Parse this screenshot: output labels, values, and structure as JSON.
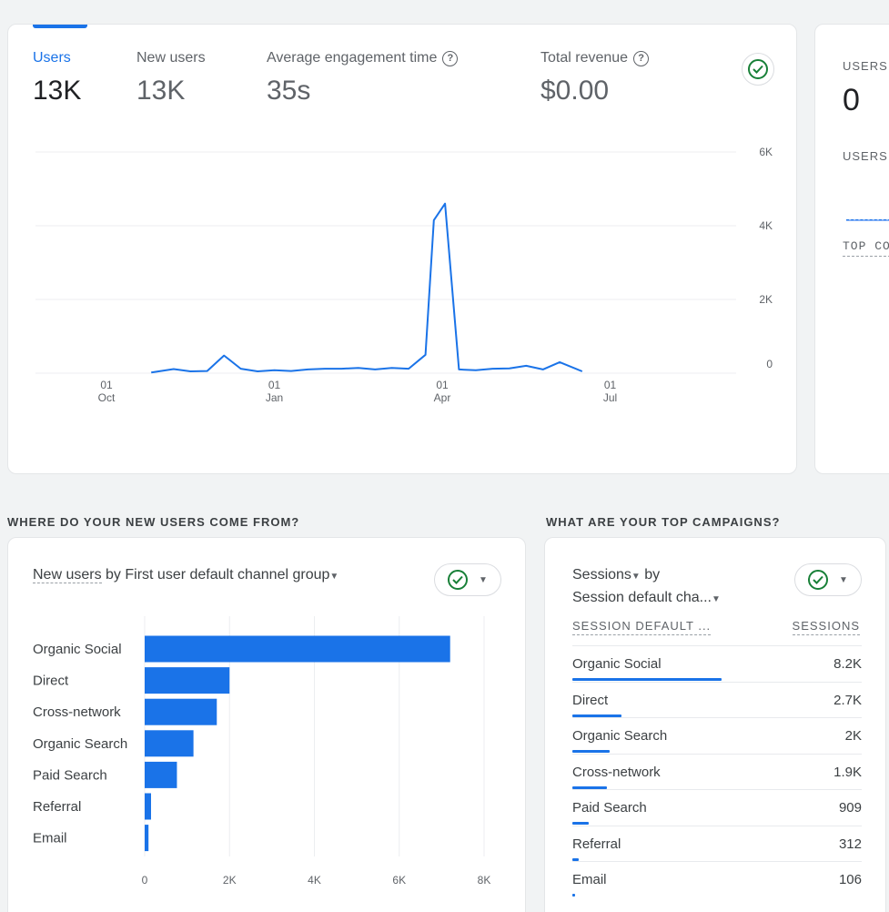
{
  "main_card": {
    "metrics": [
      {
        "label": "Users",
        "value": "13K",
        "active": true,
        "help": false
      },
      {
        "label": "New users",
        "value": "13K",
        "active": false,
        "help": false
      },
      {
        "label": "Average engagement time",
        "value": "35s",
        "active": false,
        "help": true
      },
      {
        "label": "Total revenue",
        "value": "$0.00",
        "active": false,
        "help": true
      }
    ],
    "status_icon": "check-circle-icon"
  },
  "line_chart": {
    "chart_data": {
      "type": "line",
      "y_ticks": [
        "6K",
        "4K",
        "2K",
        "0"
      ],
      "y_values": [
        6000,
        4000,
        2000,
        0
      ],
      "ylim": [
        0,
        6000
      ],
      "x_ticks": [
        {
          "day": "01",
          "month": "Oct"
        },
        {
          "day": "01",
          "month": "Jan"
        },
        {
          "day": "01",
          "month": "Apr"
        },
        {
          "day": "01",
          "month": "Jul"
        }
      ],
      "series": [
        {
          "color": "#1a73e8",
          "points": [
            [
              0.8,
              0.02
            ],
            [
              1.2,
              0.11
            ],
            [
              1.5,
              0.05
            ],
            [
              1.8,
              0.06
            ],
            [
              2.1,
              0.48
            ],
            [
              2.4,
              0.12
            ],
            [
              2.7,
              0.05
            ],
            [
              3.0,
              0.08
            ],
            [
              3.3,
              0.06
            ],
            [
              3.6,
              0.1
            ],
            [
              3.9,
              0.12
            ],
            [
              4.2,
              0.12
            ],
            [
              4.5,
              0.14
            ],
            [
              4.8,
              0.1
            ],
            [
              5.1,
              0.14
            ],
            [
              5.4,
              0.12
            ],
            [
              5.7,
              0.5
            ],
            [
              5.85,
              4.15
            ],
            [
              6.05,
              4.6
            ],
            [
              6.3,
              0.1
            ],
            [
              6.6,
              0.08
            ],
            [
              6.9,
              0.12
            ],
            [
              7.2,
              0.13
            ],
            [
              7.5,
              0.2
            ],
            [
              7.8,
              0.1
            ],
            [
              8.1,
              0.3
            ],
            [
              8.5,
              0.05
            ]
          ]
        }
      ],
      "x_axis": "month index (Oct = 0, Jan = 3, Apr = 6, Jul = 9) mapped to 3-month ticks",
      "grid": true
    }
  },
  "right_card": {
    "label1": "USERS",
    "value": "0",
    "label2": "USERS",
    "label3": "TOP CO"
  },
  "sections": {
    "new_users_title": "WHERE DO YOUR NEW USERS COME FROM?",
    "campaigns_title": "WHAT ARE YOUR TOP CAMPAIGNS?"
  },
  "bar_card": {
    "title_metric": "New users",
    "title_by": " by ",
    "title_dim": "First user default channel group",
    "chart_data": {
      "type": "bar",
      "orientation": "horizontal",
      "categories": [
        "Organic Social",
        "Direct",
        "Cross-network",
        "Organic Search",
        "Paid Search",
        "Referral",
        "Email"
      ],
      "values": [
        7200,
        2000,
        1700,
        1150,
        760,
        150,
        90
      ],
      "xlim": [
        0,
        8000
      ],
      "x_ticks": [
        "0",
        "2K",
        "4K",
        "6K",
        "8K"
      ],
      "color": "#1a73e8"
    }
  },
  "campaign_card": {
    "title_line1": "Sessions",
    "title_by": " by",
    "title_line2": "Session default cha...",
    "col1": "SESSION DEFAULT ...",
    "col2": "SESSIONS",
    "rows": [
      {
        "name": "Organic Social",
        "value": "8.2K",
        "fraction": 1.0
      },
      {
        "name": "Direct",
        "value": "2.7K",
        "fraction": 0.33
      },
      {
        "name": "Organic Search",
        "value": "2K",
        "fraction": 0.25
      },
      {
        "name": "Cross-network",
        "value": "1.9K",
        "fraction": 0.23
      },
      {
        "name": "Paid Search",
        "value": "909",
        "fraction": 0.11
      },
      {
        "name": "Referral",
        "value": "312",
        "fraction": 0.04
      },
      {
        "name": "Email",
        "value": "106",
        "fraction": 0.013
      }
    ]
  }
}
